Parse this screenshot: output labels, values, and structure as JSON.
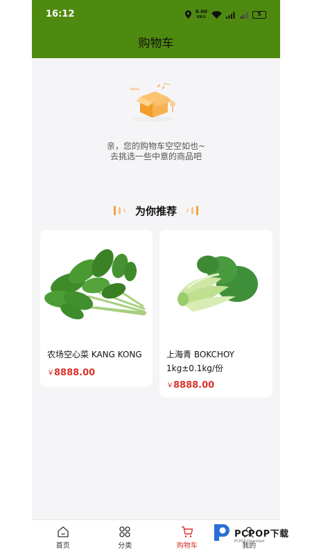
{
  "status_bar": {
    "time": "16:12",
    "speed_value": "9.00",
    "speed_unit": "KB/S",
    "battery": "5"
  },
  "header": {
    "title": "购物车"
  },
  "empty_cart": {
    "line1": "亲，您的购物车空空如也~",
    "line2": "去挑选一些中意的商品吧"
  },
  "recommend": {
    "title": "为你推荐"
  },
  "products": [
    {
      "name": "农场空心菜 KANG KONG",
      "currency": "￥",
      "price": "8888.00"
    },
    {
      "name": "上海青 BOKCHOY 1kg±0.1kg/份",
      "currency": "￥",
      "price": "8888.00"
    }
  ],
  "tabbar": {
    "items": [
      {
        "label": "首页",
        "icon": "home-icon"
      },
      {
        "label": "分类",
        "icon": "category-icon"
      },
      {
        "label": "购物车",
        "icon": "cart-icon"
      },
      {
        "label": "我的",
        "icon": "profile-icon"
      }
    ],
    "active_index": 2
  },
  "watermark": {
    "text": "PCPOP下载",
    "sub": "PCPOP Download"
  },
  "colors": {
    "header_green": "#4f8a10",
    "price_red": "#d9342b",
    "accent_orange": "#f3a23b",
    "background": "#f5f5f7"
  }
}
